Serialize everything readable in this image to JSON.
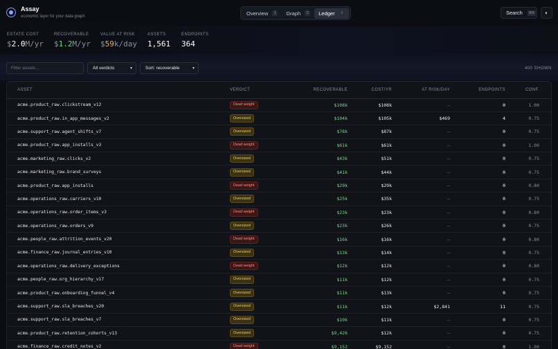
{
  "app": {
    "name": "Assay",
    "tagline": "economic layer for your data graph"
  },
  "tabs": [
    {
      "label": "Overview",
      "key": "1",
      "active": false
    },
    {
      "label": "Graph",
      "key": "2",
      "active": false
    },
    {
      "label": "Ledger",
      "key": "3",
      "active": true
    }
  ],
  "search": {
    "label": "Search",
    "shortcut": "⌘K"
  },
  "theme_icon": "◐",
  "stats": [
    {
      "label": "Estate Cost",
      "prefix": "$",
      "value": "2.0",
      "unit": "M/yr",
      "color": "#ffffff"
    },
    {
      "label": "Recoverable",
      "prefix": "$",
      "value": "1.2",
      "unit": "M/yr",
      "color": "#7fd48b"
    },
    {
      "label": "Value at Risk",
      "prefix": "$",
      "value": "59",
      "unit": "k/day",
      "color": "#f2b45a"
    },
    {
      "label": "Assets",
      "prefix": "",
      "value": "1,561",
      "unit": "",
      "color": "#ffffff"
    },
    {
      "label": "Endpoints",
      "prefix": "",
      "value": "364",
      "unit": "",
      "color": "#ffffff"
    }
  ],
  "filters": {
    "search_placeholder": "Filter assets...",
    "verdict_select": "All verdicts",
    "sort_select": "Sort: recoverable",
    "shown_count": "400 SHOWN"
  },
  "colors": {
    "accent": "#8aa4ff",
    "recoverable": "#7fd48b",
    "dead": "#ff8a80",
    "oversized": "#f2cf6a",
    "risk": "#f2b45a"
  },
  "table": {
    "headers": {
      "asset": "Asset",
      "verdict": "Verdict",
      "recoverable": "Recoverable",
      "cost": "Cost/yr",
      "risk": "At Risk/day",
      "endpoints": "Endpoints",
      "conf": "Conf."
    },
    "rows": [
      {
        "asset": "acme.product_raw.clickstream_v12",
        "verdict": "Dead weight",
        "v": "dead",
        "rec": "$108k",
        "cost": "$108k",
        "risk": "—",
        "end": "0",
        "conf": "1.00"
      },
      {
        "asset": "acme.product_raw.in_app_messages_v2",
        "verdict": "Oversized",
        "v": "over",
        "rec": "$104k",
        "cost": "$105k",
        "risk": "$469",
        "end": "4",
        "conf": "0.75"
      },
      {
        "asset": "acme.support_raw.agent_shifts_v7",
        "verdict": "Oversized",
        "v": "over",
        "rec": "$78k",
        "cost": "$87k",
        "risk": "—",
        "end": "0",
        "conf": "0.75"
      },
      {
        "asset": "acme.product_raw.app_installs_v3",
        "verdict": "Dead weight",
        "v": "dead",
        "rec": "$61k",
        "cost": "$61k",
        "risk": "—",
        "end": "0",
        "conf": "1.00"
      },
      {
        "asset": "acme.marketing_raw.clicks_v2",
        "verdict": "Oversized",
        "v": "over",
        "rec": "$43k",
        "cost": "$51k",
        "risk": "—",
        "end": "0",
        "conf": "0.75"
      },
      {
        "asset": "acme.marketing_raw.brand_surveys",
        "verdict": "Oversized",
        "v": "over",
        "rec": "$41k",
        "cost": "$44k",
        "risk": "—",
        "end": "0",
        "conf": "0.75"
      },
      {
        "asset": "acme.product_raw.app_installs",
        "verdict": "Dead weight",
        "v": "dead",
        "rec": "$29k",
        "cost": "$29k",
        "risk": "—",
        "end": "0",
        "conf": "0.80"
      },
      {
        "asset": "acme.operations_raw.carriers_v10",
        "verdict": "Oversized",
        "v": "over",
        "rec": "$25k",
        "cost": "$35k",
        "risk": "—",
        "end": "0",
        "conf": "0.75"
      },
      {
        "asset": "acme.operations_raw.order_items_v3",
        "verdict": "Dead weight",
        "v": "dead",
        "rec": "$23k",
        "cost": "$23k",
        "risk": "—",
        "end": "0",
        "conf": "0.80"
      },
      {
        "asset": "acme.operations_raw.orders_v9",
        "verdict": "Oversized",
        "v": "over",
        "rec": "$23k",
        "cost": "$26k",
        "risk": "—",
        "end": "0",
        "conf": "0.75"
      },
      {
        "asset": "acme.people_raw.attrition_events_v20",
        "verdict": "Dead weight",
        "v": "dead",
        "rec": "$16k",
        "cost": "$16k",
        "risk": "—",
        "end": "0",
        "conf": "0.80"
      },
      {
        "asset": "acme.finance_raw.journal_entries_v10",
        "verdict": "Oversized",
        "v": "over",
        "rec": "$13k",
        "cost": "$14k",
        "risk": "—",
        "end": "0",
        "conf": "0.75"
      },
      {
        "asset": "acme.operations_raw.delivery_exceptions",
        "verdict": "Dead weight",
        "v": "dead",
        "rec": "$12k",
        "cost": "$12k",
        "risk": "—",
        "end": "0",
        "conf": "0.80"
      },
      {
        "asset": "acme.people_raw.org_hierarchy_v17",
        "verdict": "Oversized",
        "v": "over",
        "rec": "$11k",
        "cost": "$12k",
        "risk": "—",
        "end": "0",
        "conf": "0.75"
      },
      {
        "asset": "acme.product_raw.onboarding_funnel_v4",
        "verdict": "Oversized",
        "v": "over",
        "rec": "$11k",
        "cost": "$13k",
        "risk": "—",
        "end": "0",
        "conf": "0.75"
      },
      {
        "asset": "acme.support_raw.sla_breaches_v20",
        "verdict": "Oversized",
        "v": "over",
        "rec": "$11k",
        "cost": "$12k",
        "risk": "$2,841",
        "end": "11",
        "conf": "0.75"
      },
      {
        "asset": "acme.support_raw.sla_breaches_v7",
        "verdict": "Oversized",
        "v": "over",
        "rec": "$10k",
        "cost": "$11k",
        "risk": "—",
        "end": "0",
        "conf": "0.75"
      },
      {
        "asset": "acme.product_raw.retention_cohorts_v13",
        "verdict": "Oversized",
        "v": "over",
        "rec": "$9,426",
        "cost": "$12k",
        "risk": "—",
        "end": "0",
        "conf": "0.75"
      },
      {
        "asset": "acme.finance_raw.credit_notes_v2",
        "verdict": "Dead weight",
        "v": "dead",
        "rec": "$9,152",
        "cost": "$9,152",
        "risk": "—",
        "end": "0",
        "conf": "1.00"
      }
    ]
  }
}
